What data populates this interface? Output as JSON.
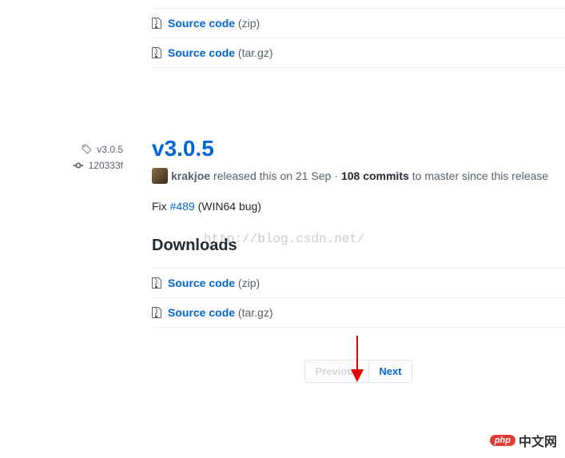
{
  "top_downloads": [
    {
      "label": "Source code",
      "format": "(zip)"
    },
    {
      "label": "Source code",
      "format": "(tar.gz)"
    }
  ],
  "sidebar": {
    "tag": "v3.0.5",
    "commit": "120333f"
  },
  "release": {
    "title": "v3.0.5",
    "author": "krakjoe",
    "released_text": "released this",
    "date": "on 21 Sep",
    "sep": "·",
    "commits_count": "108 commits",
    "commits_suffix": "to master since this release",
    "body_prefix": "Fix",
    "issue": "#489",
    "body_suffix": "(WIN64 bug)",
    "downloads_heading": "Downloads",
    "downloads": [
      {
        "label": "Source code",
        "format": "(zip)"
      },
      {
        "label": "Source code",
        "format": "(tar.gz)"
      }
    ]
  },
  "pagination": {
    "prev": "Previous",
    "next": "Next"
  },
  "watermark": "http://blog.csdn.net/",
  "footer_logo": {
    "pill": "php",
    "text": "中文网"
  }
}
